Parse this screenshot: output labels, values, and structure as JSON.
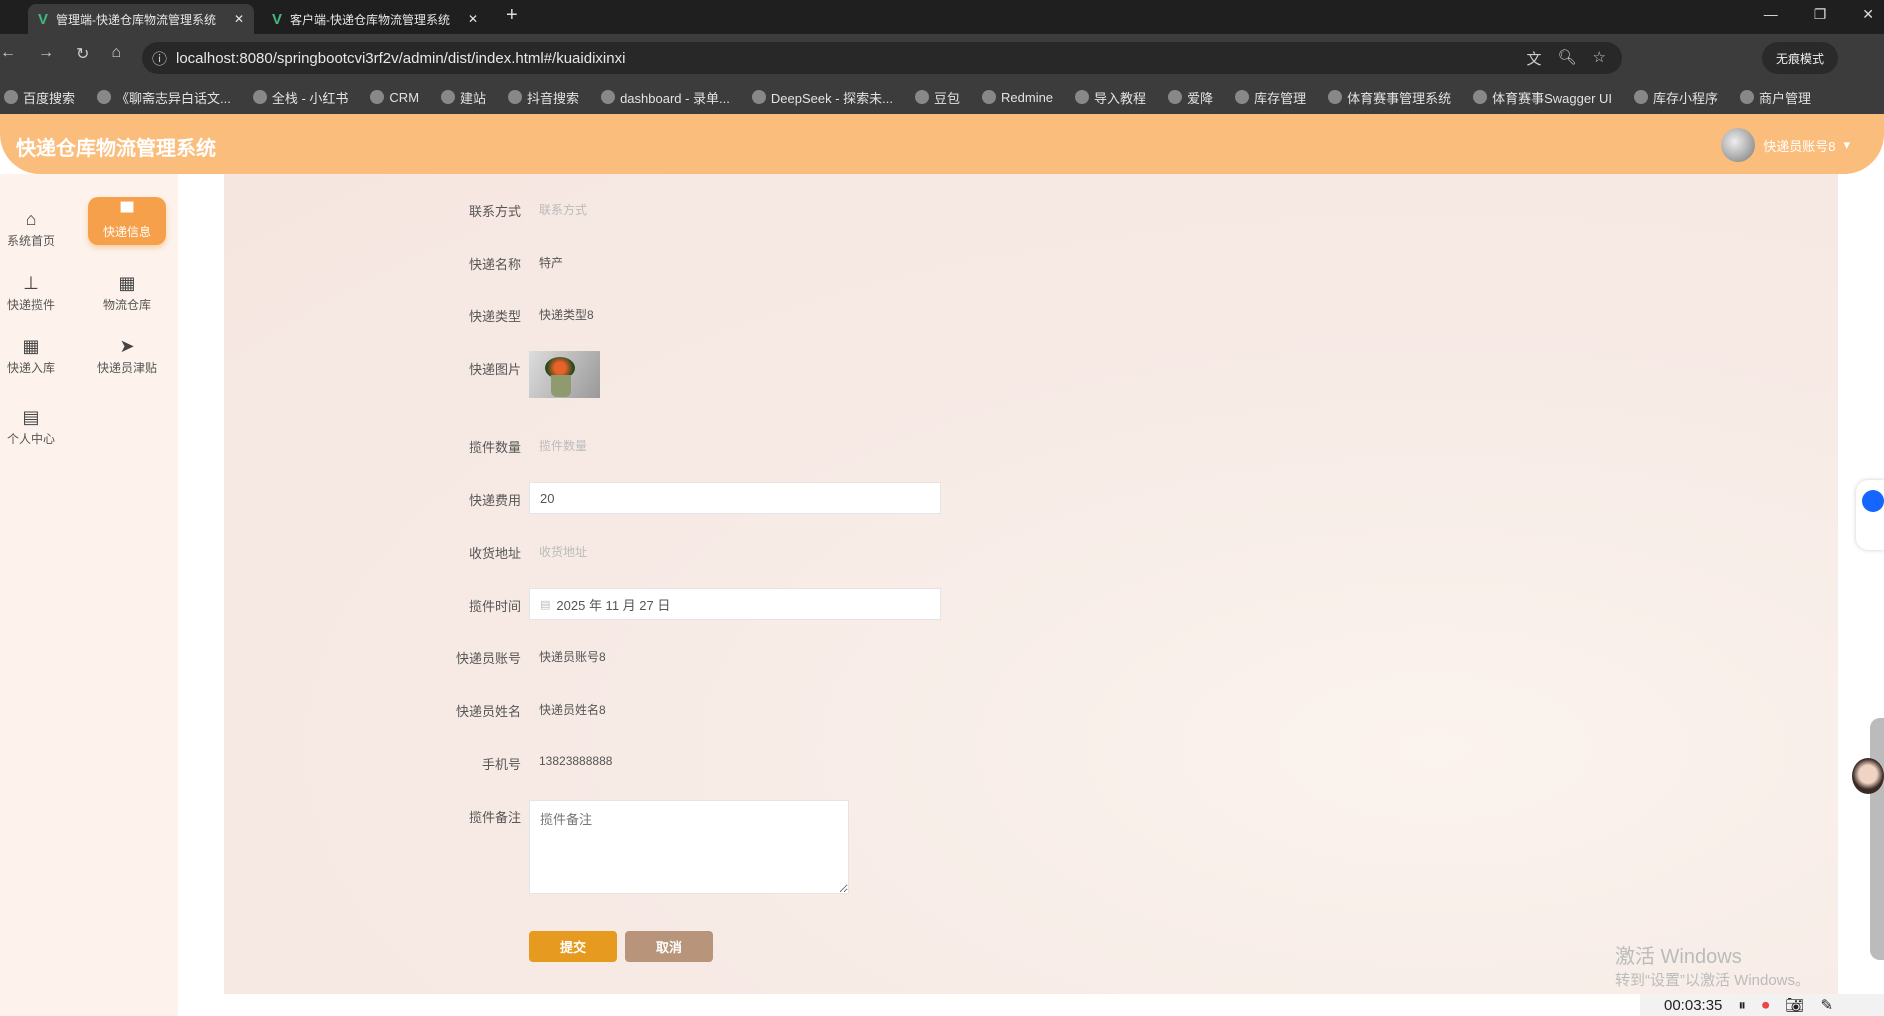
{
  "browser": {
    "tabs": [
      {
        "title": "管理端-快递仓库物流管理系统",
        "active": true
      },
      {
        "title": "客户端-快递仓库物流管理系统",
        "active": false
      }
    ],
    "url": "localhost:8080/springbootcvi3rf2v/admin/dist/index.html#/kuaidixinxi",
    "incognito_label": "无痕模式",
    "bookmarks": [
      "百度搜索",
      "《聊斋志异白话文...",
      "全栈 - 小红书",
      "CRM",
      "建站",
      "抖音搜索",
      "dashboard - 录单...",
      "DeepSeek - 探索未...",
      "豆包",
      "Redmine",
      "导入教程",
      "爱降",
      "库存管理",
      "体育赛事管理系统",
      "体育赛事Swagger UI",
      "库存小程序",
      "商户管理"
    ]
  },
  "app": {
    "title": "快递仓库物流管理系统",
    "user": "快递员账号8"
  },
  "sidebar": {
    "items": [
      {
        "label": "系统首页",
        "icon": "home-icon",
        "active": false
      },
      {
        "label": "快递信息",
        "icon": "monitor-icon",
        "active": true
      },
      {
        "label": "快递揽件",
        "icon": "stamp-icon",
        "active": false
      },
      {
        "label": "物流仓库",
        "icon": "grid-icon",
        "active": false
      },
      {
        "label": "快递入库",
        "icon": "grid-icon",
        "active": false
      },
      {
        "label": "快递员津贴",
        "icon": "send-icon",
        "active": false
      },
      {
        "label": "个人中心",
        "icon": "wallet-icon",
        "active": false
      }
    ]
  },
  "form": {
    "contact": {
      "label": "联系方式",
      "placeholder": "联系方式"
    },
    "name": {
      "label": "快递名称",
      "value": "特产"
    },
    "type": {
      "label": "快递类型",
      "value": "快递类型8"
    },
    "image": {
      "label": "快递图片"
    },
    "quantity": {
      "label": "揽件数量",
      "placeholder": "揽件数量"
    },
    "fee": {
      "label": "快递费用",
      "value": "20"
    },
    "address": {
      "label": "收货地址",
      "placeholder": "收货地址"
    },
    "time": {
      "label": "揽件时间",
      "value": "2025 年 11 月 27 日"
    },
    "courier_account": {
      "label": "快递员账号",
      "value": "快递员账号8"
    },
    "courier_name": {
      "label": "快递员姓名",
      "value": "快递员姓名8"
    },
    "phone": {
      "label": "手机号",
      "value": "13823888888"
    },
    "remark": {
      "label": "揽件备注",
      "placeholder": "揽件备注"
    },
    "submit_label": "提交",
    "cancel_label": "取消"
  },
  "colors": {
    "header": "#fbbd7c",
    "active_nav": "#f7a04b",
    "submit": "#e69a1f",
    "cancel": "#b8957a"
  },
  "overlay": {
    "watermark_title": "激活 Windows",
    "watermark_sub": "转到“设置”以激活 Windows。",
    "recorder_time": "00:03:35"
  }
}
